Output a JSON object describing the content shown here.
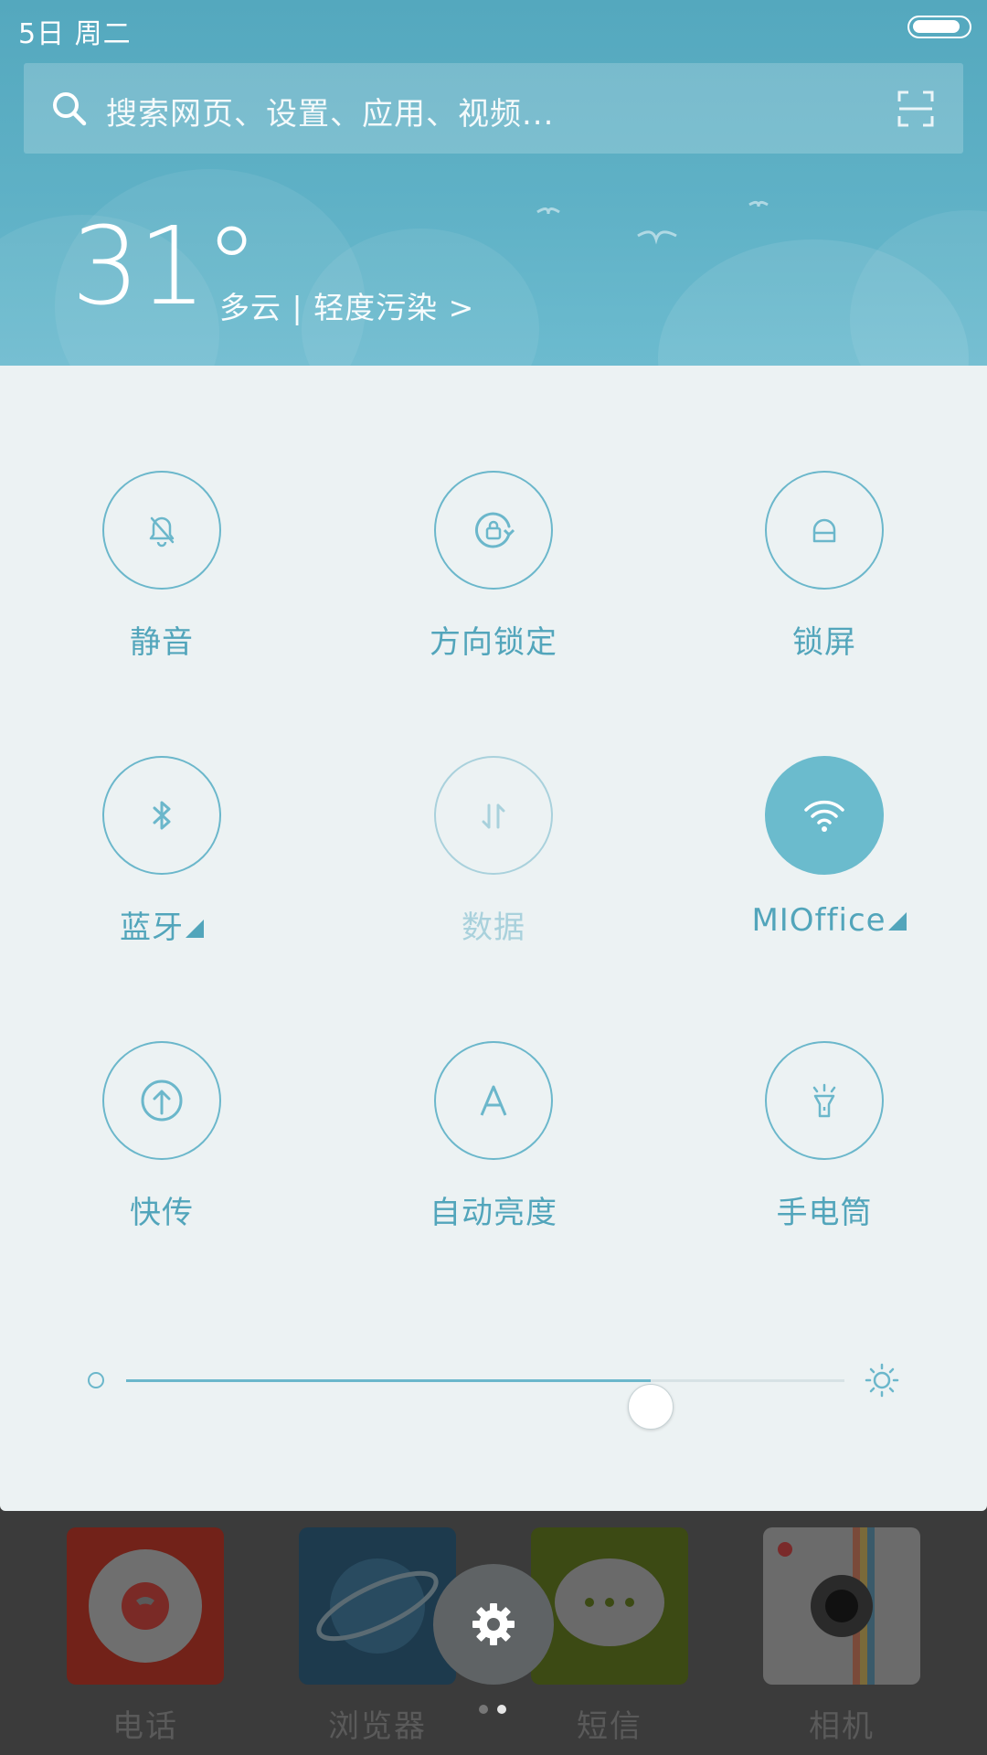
{
  "status_bar": {
    "date": "5日 周二",
    "battery_level": 0.9
  },
  "search": {
    "placeholder": "搜索网页、设置、应用、视频..."
  },
  "weather": {
    "temperature": "31°",
    "description": "多云 | 轻度污染 >"
  },
  "toggles": [
    {
      "label": "静音",
      "icon": "bell-off-icon",
      "state": "off"
    },
    {
      "label": "方向锁定",
      "icon": "rotation-lock-icon",
      "state": "off"
    },
    {
      "label": "锁屏",
      "icon": "lock-icon",
      "state": "off"
    },
    {
      "label": "蓝牙",
      "icon": "bluetooth-icon",
      "state": "off"
    },
    {
      "label": "数据",
      "icon": "data-transfer-icon",
      "state": "disabled"
    },
    {
      "label": "MIOffice",
      "icon": "wifi-icon",
      "state": "on"
    },
    {
      "label": "快传",
      "icon": "upload-icon",
      "state": "off"
    },
    {
      "label": "自动亮度",
      "icon": "auto-brightness-icon",
      "state": "off"
    },
    {
      "label": "手电筒",
      "icon": "flashlight-icon",
      "state": "off"
    }
  ],
  "brightness": {
    "level": 0.73
  },
  "dock": {
    "apps": [
      {
        "label": "电话",
        "icon": "phone-icon"
      },
      {
        "label": "浏览器",
        "icon": "browser-icon"
      },
      {
        "label": "短信",
        "icon": "messages-icon"
      },
      {
        "label": "相机",
        "icon": "camera-icon"
      }
    ],
    "page_count": 2,
    "current_page": 2
  },
  "colors": {
    "accent": "#6bb7cb",
    "header": "#5fb1c6",
    "panel": "#ecf2f3"
  }
}
